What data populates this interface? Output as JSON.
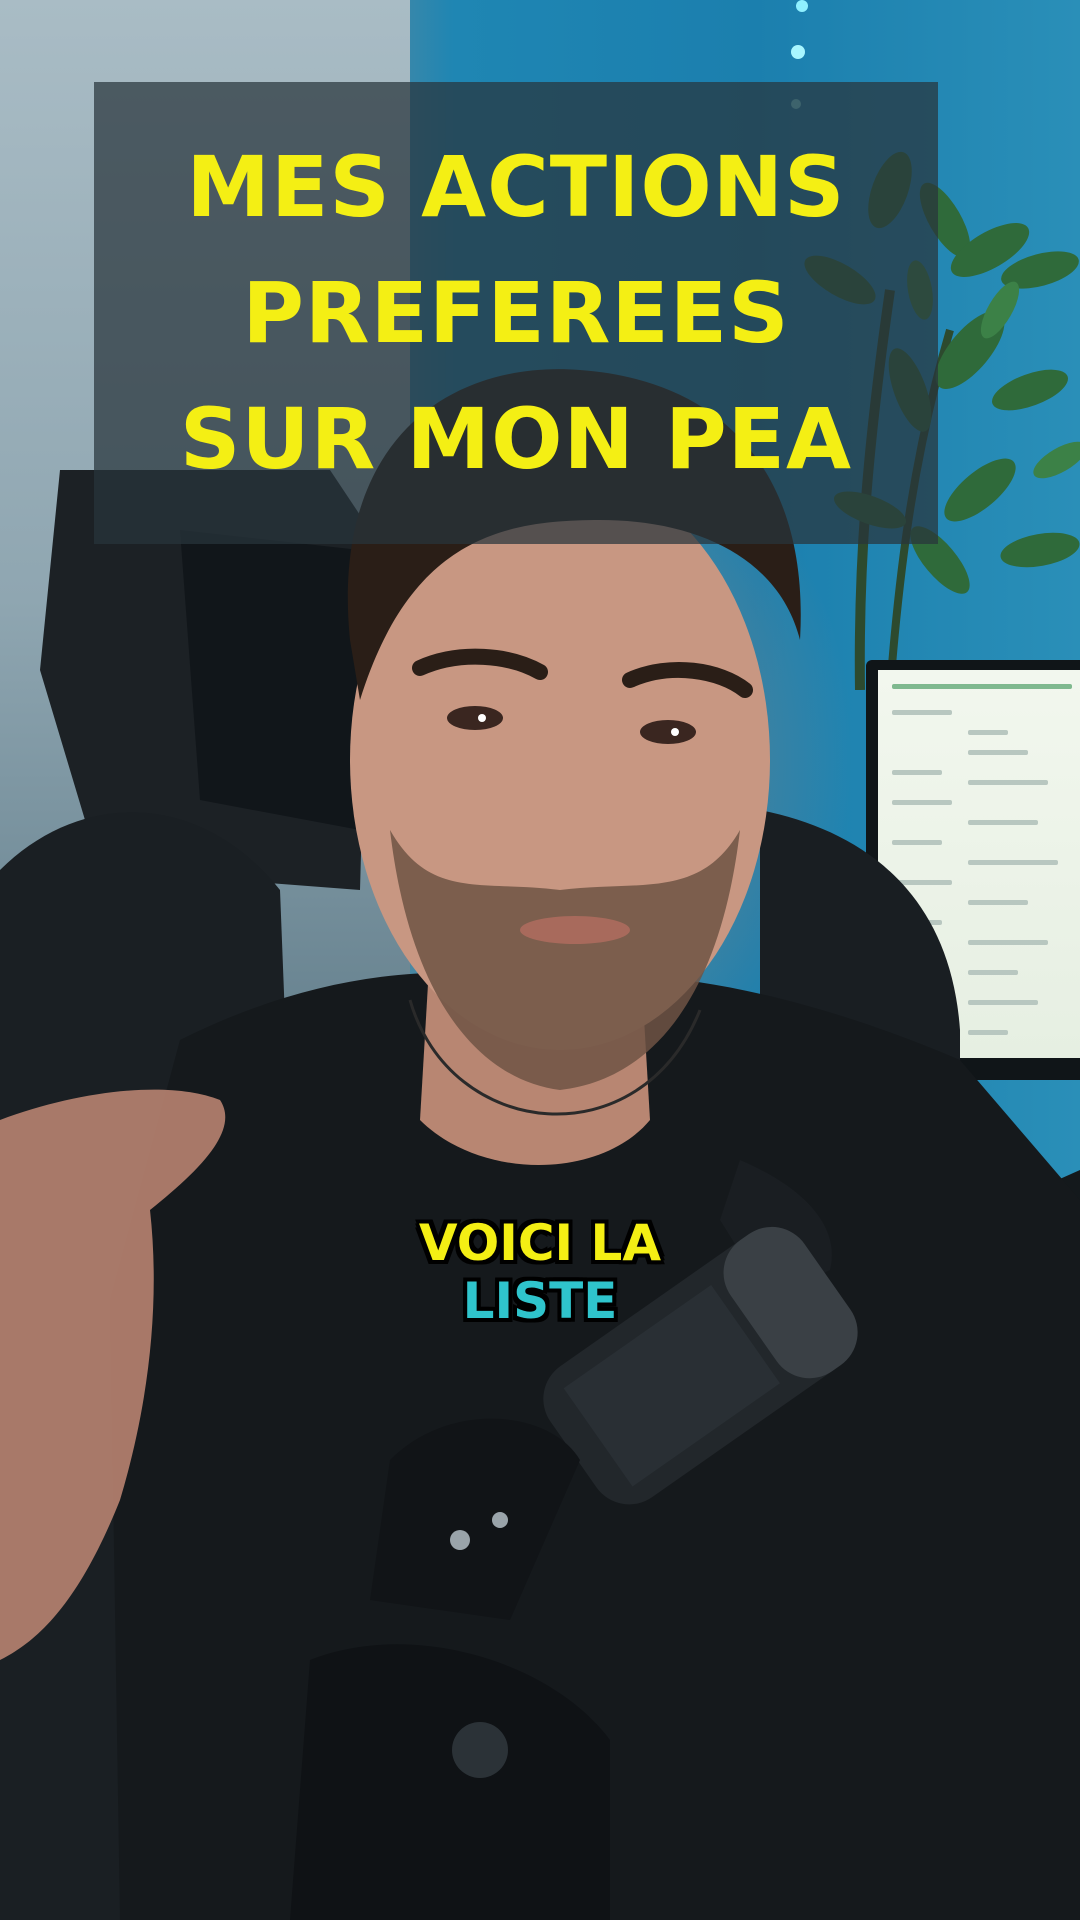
{
  "title": {
    "lines": [
      "MES ACTIONS",
      "PREFEREES",
      "SUR MON PEA"
    ],
    "color": "#f4ef14",
    "box_color": "#28343c"
  },
  "caption": {
    "line1": "VOICI LA",
    "line2": "LISTE",
    "line1_color": "#f4ef14",
    "line2_color": "#2fc4cc"
  },
  "scene": {
    "description_tags": [
      "plant-icon",
      "monitor",
      "gaming-chair",
      "microphone"
    ]
  }
}
